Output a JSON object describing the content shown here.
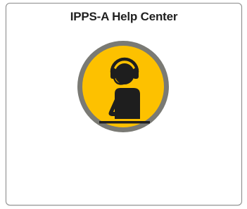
{
  "tile": {
    "title": "IPPS-A Help Center",
    "icon": "help-desk-agent-icon",
    "colors": {
      "icon_fill": "#FDC100",
      "icon_ring": "#7A7A74",
      "figure": "#1E1E1E",
      "border": "#8A8A8A"
    }
  }
}
